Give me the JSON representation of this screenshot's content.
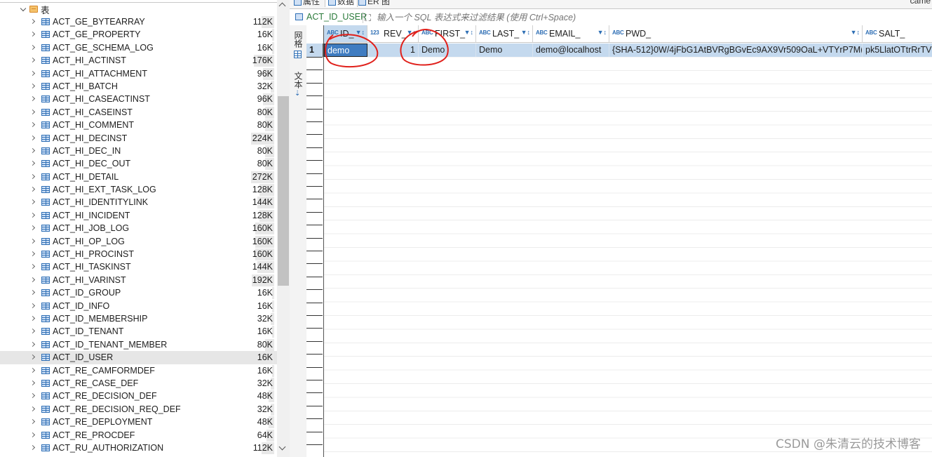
{
  "tree": {
    "root_label": "表",
    "items": [
      {
        "name": "ACT_GE_BYTEARRAY",
        "size": "112K"
      },
      {
        "name": "ACT_GE_PROPERTY",
        "size": "16K"
      },
      {
        "name": "ACT_GE_SCHEMA_LOG",
        "size": "16K"
      },
      {
        "name": "ACT_HI_ACTINST",
        "size": "176K"
      },
      {
        "name": "ACT_HI_ATTACHMENT",
        "size": "96K"
      },
      {
        "name": "ACT_HI_BATCH",
        "size": "32K"
      },
      {
        "name": "ACT_HI_CASEACTINST",
        "size": "96K"
      },
      {
        "name": "ACT_HI_CASEINST",
        "size": "80K"
      },
      {
        "name": "ACT_HI_COMMENT",
        "size": "80K"
      },
      {
        "name": "ACT_HI_DECINST",
        "size": "224K"
      },
      {
        "name": "ACT_HI_DEC_IN",
        "size": "80K"
      },
      {
        "name": "ACT_HI_DEC_OUT",
        "size": "80K"
      },
      {
        "name": "ACT_HI_DETAIL",
        "size": "272K"
      },
      {
        "name": "ACT_HI_EXT_TASK_LOG",
        "size": "128K"
      },
      {
        "name": "ACT_HI_IDENTITYLINK",
        "size": "144K"
      },
      {
        "name": "ACT_HI_INCIDENT",
        "size": "128K"
      },
      {
        "name": "ACT_HI_JOB_LOG",
        "size": "160K"
      },
      {
        "name": "ACT_HI_OP_LOG",
        "size": "160K"
      },
      {
        "name": "ACT_HI_PROCINST",
        "size": "160K"
      },
      {
        "name": "ACT_HI_TASKINST",
        "size": "144K"
      },
      {
        "name": "ACT_HI_VARINST",
        "size": "192K"
      },
      {
        "name": "ACT_ID_GROUP",
        "size": "16K"
      },
      {
        "name": "ACT_ID_INFO",
        "size": "16K"
      },
      {
        "name": "ACT_ID_MEMBERSHIP",
        "size": "32K"
      },
      {
        "name": "ACT_ID_TENANT",
        "size": "16K"
      },
      {
        "name": "ACT_ID_TENANT_MEMBER",
        "size": "80K"
      },
      {
        "name": "ACT_ID_USER",
        "size": "16K"
      },
      {
        "name": "ACT_RE_CAMFORMDEF",
        "size": "16K"
      },
      {
        "name": "ACT_RE_CASE_DEF",
        "size": "32K"
      },
      {
        "name": "ACT_RE_DECISION_DEF",
        "size": "48K"
      },
      {
        "name": "ACT_RE_DECISION_REQ_DEF",
        "size": "32K"
      },
      {
        "name": "ACT_RE_DEPLOYMENT",
        "size": "48K"
      },
      {
        "name": "ACT_RE_PROCDEF",
        "size": "64K"
      },
      {
        "name": "ACT_RU_AUTHORIZATION",
        "size": "112K"
      }
    ],
    "selected_index": 26,
    "size_bar_fractions": [
      0.41,
      0.06,
      0.06,
      0.65,
      0.35,
      0.12,
      0.35,
      0.29,
      0.29,
      0.82,
      0.29,
      0.29,
      1.0,
      0.47,
      0.53,
      0.47,
      0.59,
      0.59,
      0.59,
      0.53,
      0.71,
      0.06,
      0.06,
      0.12,
      0.06,
      0.29,
      0.06,
      0.06,
      0.12,
      0.18,
      0.12,
      0.18,
      0.24,
      0.41
    ]
  },
  "editor_tabs": {
    "properties": "属性",
    "data": "数据",
    "er": "ER 图",
    "right_label": "came"
  },
  "filter": {
    "table_name": "ACT_ID_USER",
    "placeholder": "输入一个 SQL 表达式来过滤结果 (使用 Ctrl+Space)"
  },
  "side_tabs": {
    "grid": "网格",
    "text": "文本"
  },
  "grid": {
    "columns": [
      {
        "type": "ABC",
        "name": "ID_"
      },
      {
        "type": "123",
        "name": "REV_"
      },
      {
        "type": "ABC",
        "name": "FIRST_"
      },
      {
        "type": "ABC",
        "name": "LAST_"
      },
      {
        "type": "ABC",
        "name": "EMAIL_"
      },
      {
        "type": "ABC",
        "name": "PWD_"
      },
      {
        "type": "ABC",
        "name": "SALT_"
      }
    ],
    "rows": [
      {
        "num": "1",
        "cells": [
          "demo",
          "1",
          "Demo",
          "Demo",
          "demo@localhost",
          "{SHA-512}0W/4jFbG1AtBVRgBGvEc9AX9Vr509OaL+VTYrP7M(",
          "pk5LlatOTtrRrTV"
        ]
      }
    ]
  },
  "watermark": "CSDN @朱清云的技术博客",
  "colors": {
    "selection": "#c4d9ee",
    "focused_cell": "#3f7cc1",
    "annotation": "#e0201b",
    "table_name": "#2a7a3a"
  }
}
